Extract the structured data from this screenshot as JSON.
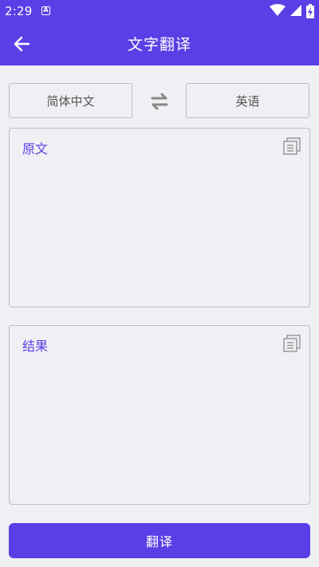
{
  "status_bar": {
    "time": "2:29",
    "notification_icon": "a-icon",
    "icons": [
      "wifi-icon",
      "signal-icon",
      "battery-charging-icon"
    ]
  },
  "header": {
    "title": "文字翻译",
    "back_icon": "arrow-left-icon"
  },
  "languages": {
    "source": "简体中文",
    "target": "英语",
    "swap_icon": "swap-icon"
  },
  "source_box": {
    "label": "原文",
    "text": "",
    "copy_icon": "copy-icon"
  },
  "result_box": {
    "label": "结果",
    "text": "",
    "copy_icon": "copy-icon"
  },
  "actions": {
    "translate_label": "翻译"
  },
  "colors": {
    "accent": "#5a3fe6",
    "background": "#f0eff3",
    "border": "#bdbdc2"
  }
}
